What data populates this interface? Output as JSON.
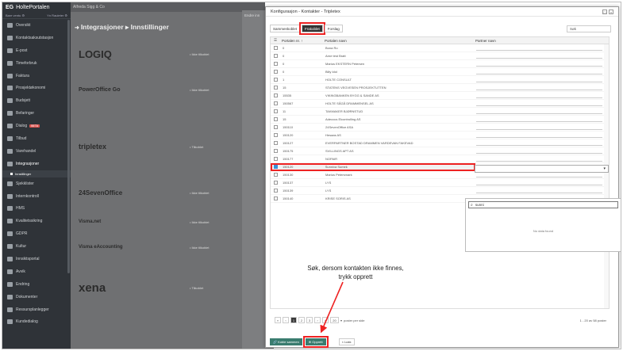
{
  "sidebar": {
    "brand": "HoltePortalen",
    "brand_prefix": "EG",
    "filter_left": "Bare ventu ⚙",
    "filter_right": "Yn Rauleter ⚙",
    "items": [
      {
        "label": "Oversikt",
        "icon": "home-icon"
      },
      {
        "label": "Kontaktsaksutstasjon",
        "icon": "contacts-icon"
      },
      {
        "label": "E-post",
        "icon": "mail-icon"
      },
      {
        "label": "Timeforbruk",
        "icon": "clock-icon"
      },
      {
        "label": "Faktura",
        "icon": "invoice-icon"
      },
      {
        "label": "Prosjektøkonomi",
        "icon": "chart-icon"
      },
      {
        "label": "Budsjett",
        "icon": "budget-icon"
      },
      {
        "label": "Befaringer",
        "icon": "inspection-icon"
      },
      {
        "label": "Dialog",
        "icon": "chat-icon",
        "badge": "BETA"
      },
      {
        "label": "Tilbud",
        "icon": "offer-icon"
      },
      {
        "label": "Varehandel",
        "icon": "cart-icon"
      },
      {
        "label": "Integrasjoner",
        "icon": "plug-icon",
        "active": true
      }
    ],
    "sub_item": "Innstillinger",
    "items_after": [
      {
        "label": "Sjekklister",
        "icon": "checklist-icon"
      },
      {
        "label": "Internkontroll",
        "icon": "shield-icon"
      },
      {
        "label": "HMS",
        "icon": "warning-icon"
      },
      {
        "label": "Kvalitetssikring",
        "icon": "quality-icon"
      },
      {
        "label": "GDPR",
        "icon": "lock-icon"
      },
      {
        "label": "Kultur",
        "icon": "culture-icon"
      },
      {
        "label": "Innsiktsportal",
        "icon": "insight-icon"
      },
      {
        "label": "Avvik",
        "icon": "deviation-icon"
      },
      {
        "label": "Endring",
        "icon": "change-icon"
      },
      {
        "label": "Dokumenter",
        "icon": "document-icon"
      },
      {
        "label": "Ressursplanlegger",
        "icon": "calendar-icon"
      },
      {
        "label": "Kundedialog",
        "icon": "customer-icon"
      }
    ]
  },
  "background": {
    "topbar": "Alfreda Sigg & Co",
    "title": "Integrasjoner ▸ Innstillinger",
    "logos": [
      {
        "text": "LOGIQ",
        "status": "• Ikke tilkoblet"
      },
      {
        "text": "PowerOffice Go",
        "status": "• Ikke tilkoblet"
      },
      {
        "text": "tripletex",
        "status": "• Tilkoblet"
      },
      {
        "text": "24SevenOffice",
        "status": "• Ikke tilkoblet"
      },
      {
        "text": "Visma.net",
        "status": "• Ikke tilkoblet"
      },
      {
        "text": "Visma eAccounting",
        "status": "• Ikke tilkoblet"
      },
      {
        "text": "xena",
        "status": "• Tilkoblet"
      }
    ],
    "drawer_header": "Endre inn"
  },
  "dialog": {
    "title": "Konfigurasjon - Kontakter - Tripletex",
    "tabs": [
      "Sammenkoblet",
      "Frakoblet",
      "Forslag"
    ],
    "selected_tab": "Frakoblet",
    "search_placeholder": "Søk",
    "columns": [
      "Portalen nr. ↑",
      "Portalen navn",
      "Partner navn"
    ],
    "rows": [
      {
        "nr": "0",
        "name": "Bona Ro",
        "checked": false
      },
      {
        "nr": "0",
        "name": "Arne test Bratt",
        "checked": false
      },
      {
        "nr": "0",
        "name": "Marius EKSTERN Petersen",
        "checked": false
      },
      {
        "nr": "0",
        "name": "Billy Idol",
        "checked": false
      },
      {
        "nr": "1",
        "name": "HOLTE CONSULT",
        "checked": false
      },
      {
        "nr": "15",
        "name": "STATENS VEGVESEN PROSJEKTUTTEN",
        "checked": false
      },
      {
        "nr": "15535",
        "name": "VIKINGBANKEN BYGG & SANDE AS",
        "checked": false
      },
      {
        "nr": "150567",
        "name": "HOLTE SÅGÅ DRAMMENSEL AS",
        "checked": false
      },
      {
        "nr": "11",
        "name": "TAKMAKER BJØRNSTUD",
        "checked": false
      },
      {
        "nr": "15",
        "name": "Adeccus Elcontrolling AS",
        "checked": false
      },
      {
        "nr": "150110",
        "name": "24SevenOffice ASA",
        "checked": false
      },
      {
        "nr": "150120",
        "name": "Hesaas AS",
        "checked": false
      },
      {
        "nr": "150127",
        "name": "EVERPARTNER BOSTAD DRAMMEN VARDEVAN FAKEVAD",
        "checked": false
      },
      {
        "nr": "150175",
        "name": "SVILLINGS APT AS",
        "checked": false
      },
      {
        "nr": "150177",
        "name": "NOPAIR",
        "checked": false
      },
      {
        "nr": "150120",
        "name": "Sunniva Sumek",
        "checked": true,
        "selected": true
      },
      {
        "nr": "150130",
        "name": "Marius Petersmark",
        "checked": false
      },
      {
        "nr": "150137",
        "name": "LYS",
        "checked": false
      },
      {
        "nr": "150139",
        "name": "LYS",
        "checked": false
      },
      {
        "nr": "150140",
        "name": "KRISE SORIS AS",
        "checked": false
      }
    ],
    "partner_search_value": "sunni",
    "no_data": "No data found",
    "pager": {
      "pages": [
        "1",
        "2",
        "3"
      ],
      "current": "1",
      "per_page": "20",
      "per_page_label": "poster per side",
      "info": "1 - 20 av 58 poster"
    },
    "buttons": {
      "link": "Koble sammen",
      "create": "Opprett",
      "close": "× Lukk"
    },
    "annotation": "Søk, dersom kontakten ikke finnes, trykk opprett"
  },
  "colors": {
    "highlight_red": "#e22222",
    "sidebar_bg": "#2f3338",
    "button_green": "#3a7c6f"
  }
}
